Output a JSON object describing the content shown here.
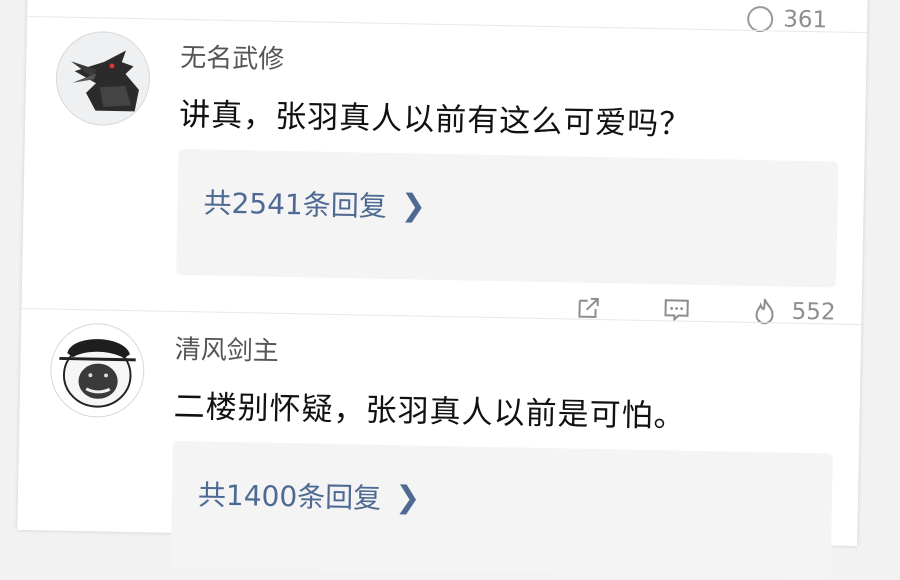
{
  "prev_comment": {
    "like_count": "361"
  },
  "comments": [
    {
      "username": "无名武修",
      "content": "讲真，张羽真人以前有这么可爱吗？",
      "reply_link": "共2541条回复",
      "like_count": "552",
      "avatar_icon": "crow-avatar"
    },
    {
      "username": "清风剑主",
      "content": "二楼别怀疑，张羽真人以前是可怕。",
      "reply_link": "共1400条回复",
      "avatar_icon": "meme-face-avatar"
    }
  ],
  "icons": {
    "reply_chevron": "chevron-right-icon",
    "share": "share-icon",
    "comment": "comment-icon",
    "like": "flame-icon"
  },
  "colors": {
    "link": "#4f6a92",
    "reply_bg": "#f4f4f5",
    "meta": "#8e8e8e"
  }
}
